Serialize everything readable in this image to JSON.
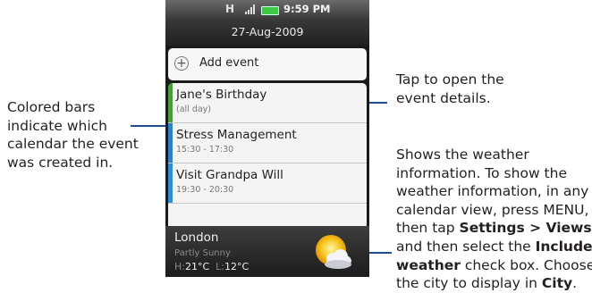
{
  "callouts": {
    "left": [
      "Colored bars",
      "indicate which",
      "calendar the event",
      "was created in."
    ],
    "tap_event": [
      "Tap to open the",
      "event details."
    ],
    "weather": {
      "line1": "Shows the weather",
      "line2": "information. To show the",
      "line3": "weather information, in any",
      "line4": "calendar view, press MENU,",
      "line5_pre": "then tap ",
      "line5_bold": "Settings > Views",
      "line6_pre": "and then select the ",
      "line6_bold": "Include",
      "line7_bold": "weather",
      "line7_post": " check box. Choose",
      "line8_pre": "the city to display in ",
      "line8_bold": "City",
      "line8_post": "."
    }
  },
  "status_bar": {
    "signal_glyph": "H",
    "time": "9:59 PM",
    "battery_color": "#3fc843"
  },
  "date_header": "27-Aug-2009",
  "add_event_label": "Add event",
  "events": [
    {
      "title": "Jane's Birthday",
      "sub": "(all day)",
      "color": "#4a9a3a"
    },
    {
      "title": "Stress Management",
      "sub": "15:30 - 17:30",
      "color": "#2f7fc6"
    },
    {
      "title": "Visit Grandpa Will",
      "sub": "19:30 - 20:30",
      "color": "#2f8fd0"
    }
  ],
  "weather": {
    "city": "London",
    "condition": "Partly Sunny",
    "high_label": "H:",
    "high": "21°C",
    "low_label": "L:",
    "low": "12°C",
    "icon": "partly-sunny-icon"
  },
  "colors": {
    "pointer": "#1f4e8c"
  }
}
